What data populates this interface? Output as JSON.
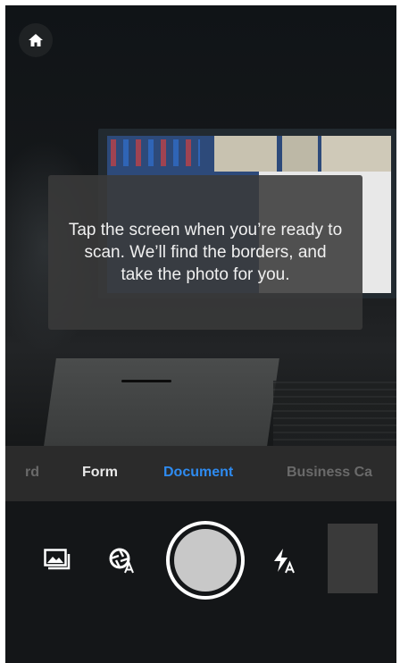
{
  "hint": {
    "text": "Tap the screen when you’re ready to scan. We’ll find the borders, and take the photo for you."
  },
  "modes": [
    {
      "label": "rd",
      "state": "partial"
    },
    {
      "label": "Form",
      "state": "normal"
    },
    {
      "label": "Document",
      "state": "selected"
    },
    {
      "label": "Business Ca",
      "state": "partial"
    }
  ],
  "colors": {
    "accent": "#2e8bf0",
    "mode_bar": "#2b2b2b",
    "control_bar": "#141618"
  },
  "icons": {
    "home": "home-icon",
    "gallery": "image-gallery-icon",
    "auto_capture": "auto-capture-icon",
    "flash": "flash-auto-icon"
  }
}
